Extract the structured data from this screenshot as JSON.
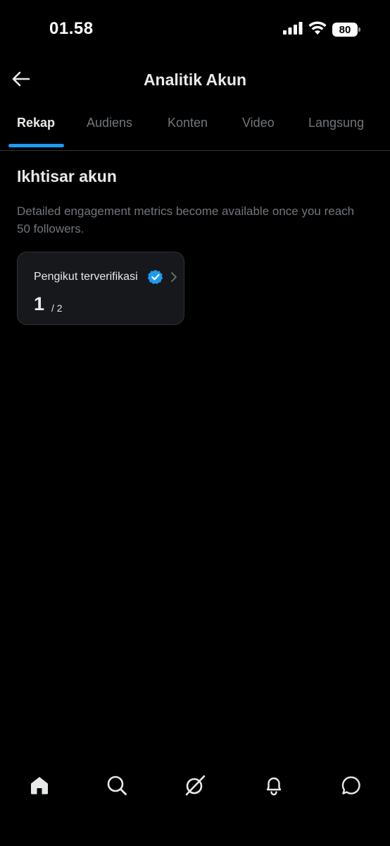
{
  "status_bar": {
    "time": "01.58",
    "battery": "80",
    "signal_icon": "cellular-signal-icon",
    "wifi_icon": "wifi-icon"
  },
  "header": {
    "title": "Analitik Akun",
    "back_icon": "arrow-left-icon"
  },
  "tabs": [
    {
      "label": "Rekap",
      "active": true
    },
    {
      "label": "Audiens",
      "active": false
    },
    {
      "label": "Konten",
      "active": false
    },
    {
      "label": "Video",
      "active": false
    },
    {
      "label": "Langsung",
      "active": false
    }
  ],
  "overview": {
    "title": "Ikhtisar akun",
    "description": "Detailed engagement metrics become available once you reach 50 followers.",
    "card": {
      "label": "Pengikut terverifikasi",
      "value": "1",
      "total": "/ 2",
      "badge_icon": "verified-badge-icon",
      "chevron_icon": "chevron-right-icon"
    }
  },
  "bottom_nav": [
    {
      "name": "home-icon",
      "active": true
    },
    {
      "name": "search-icon",
      "active": false
    },
    {
      "name": "grok-icon",
      "active": false
    },
    {
      "name": "bell-icon",
      "active": false
    },
    {
      "name": "chat-icon",
      "active": false
    }
  ],
  "colors": {
    "background": "#000000",
    "accent": "#1d9bf0",
    "text_primary": "#e7e9ea",
    "text_secondary": "#71767b",
    "card_background": "#16181c",
    "border": "#2f3336"
  }
}
